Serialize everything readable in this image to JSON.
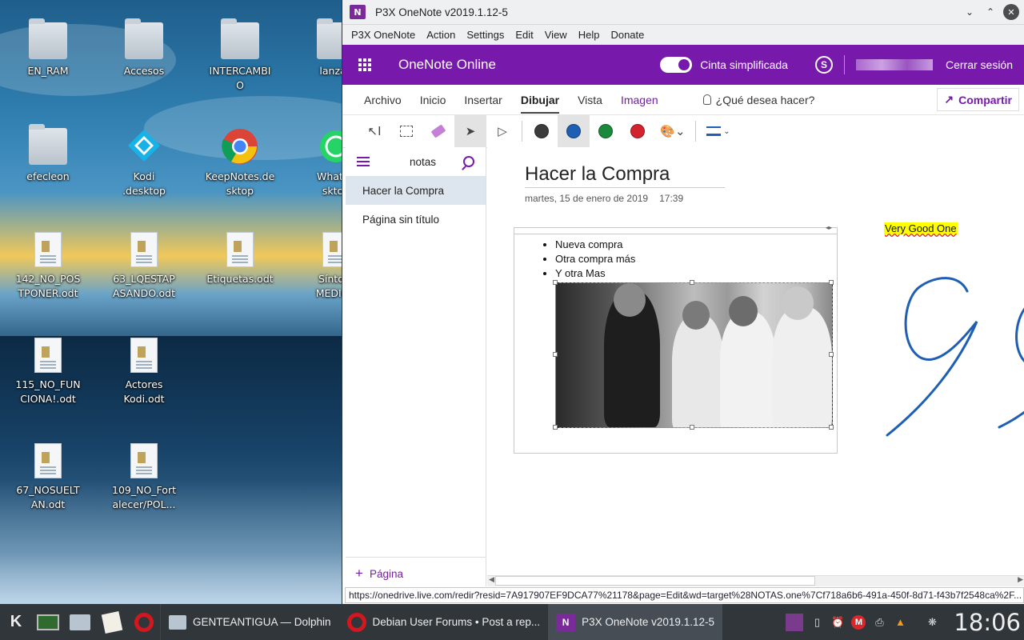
{
  "desktop": {
    "icons": [
      {
        "label": "EN_RAM",
        "kind": "folder"
      },
      {
        "label": "Accesos",
        "kind": "folder"
      },
      {
        "label": "INTERCAMBIO",
        "kind": "folder"
      },
      {
        "label": "lanzad",
        "kind": "folder"
      },
      {
        "label": "efecleon",
        "kind": "user-folder"
      },
      {
        "label": "Kodi .desktop",
        "kind": "kodi"
      },
      {
        "label": "KeepNotes.desktop",
        "kind": "chrome"
      },
      {
        "label": "WhatsA sktop",
        "kind": "whatsapp"
      },
      {
        "label": "142_NO_POSTPONER.odt",
        "kind": "doc"
      },
      {
        "label": "63_LQESTAPASANDO.odt",
        "kind": "doc"
      },
      {
        "label": "Etiquetas.odt",
        "kind": "doc"
      },
      {
        "label": "Síntom MEDICO",
        "kind": "doc"
      },
      {
        "label": "115_NO_FUNCIONA!.odt",
        "kind": "doc"
      },
      {
        "label": "Actores Kodi.odt",
        "kind": "doc"
      },
      {
        "label": "67_NOSUELTAN.odt",
        "kind": "doc"
      },
      {
        "label": "109_NO_Fortalecer/POL...",
        "kind": "doc"
      }
    ]
  },
  "window": {
    "title": "P3X OneNote v2019.1.12-5",
    "menu": [
      "P3X OneNote",
      "Action",
      "Settings",
      "Edit",
      "View",
      "Help",
      "Donate"
    ]
  },
  "header": {
    "brand": "OneNote Online",
    "ribbon_toggle_label": "Cinta simplificada",
    "signout": "Cerrar sesión"
  },
  "ribbon": {
    "tabs": [
      {
        "label": "Archivo"
      },
      {
        "label": "Inicio"
      },
      {
        "label": "Insertar"
      },
      {
        "label": "Dibujar",
        "active": true
      },
      {
        "label": "Vista"
      },
      {
        "label": "Imagen",
        "contextual": true
      }
    ],
    "tell_me": "¿Qué desea hacer?",
    "share": "Compartir",
    "tools": [
      "type-select-icon",
      "lasso-icon",
      "eraser-icon",
      "pen-select-icon",
      "pen-icon"
    ],
    "colors": [
      "#3b3b3b",
      "#1e5fb4",
      "#1a8a3a",
      "#d2232e"
    ]
  },
  "sidebar": {
    "notebook": "notas",
    "pages": [
      {
        "title": "Hacer la Compra",
        "selected": true
      },
      {
        "title": "Página sin título"
      }
    ],
    "add_page": "Página"
  },
  "page": {
    "title": "Hacer la Compra",
    "date": "martes, 15 de enero de 2019",
    "time": "17:39",
    "bullets": [
      "Nueva compra",
      "Otra compra más",
      "Y otra Mas"
    ],
    "highlight_note": "Very Good One",
    "ink_color": "#1e5fb4"
  },
  "status": {
    "url": "https://onedrive.live.com/redir?resid=7A917907EF9DCA77%21178&page=Edit&wd=target%28NOTAS.one%7Cf718a6b6-491a-450f-8d71-f43b7f2548ca%2F..."
  },
  "taskbar": {
    "tasks": [
      {
        "label": "GENTEANTIGUA — Dolphin"
      },
      {
        "label": "Debian User Forums • Post a rep..."
      },
      {
        "label": "P3X OneNote v2019.1.12-5",
        "active": true
      }
    ],
    "clock": "18:06"
  }
}
